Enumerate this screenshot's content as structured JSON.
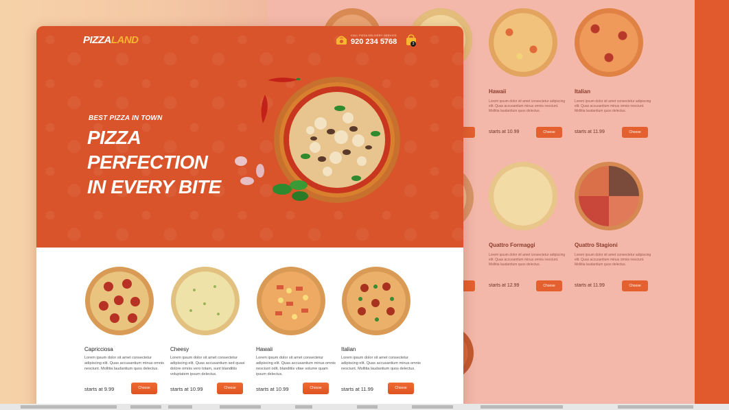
{
  "header": {
    "logo_part1": "PIZZA",
    "logo_part2": "LAND",
    "phone_label": "CALL PIZZA DELIVERY SERVICE",
    "phone_number": "920 234 5768",
    "cart_count": "3"
  },
  "hero": {
    "subtitle": "BEST PIZZA IN TOWN",
    "title_line1": "PIZZA PERFECTION",
    "title_line2": "IN EVERY BITE"
  },
  "products": [
    {
      "name": "Capricciosa",
      "desc": "Lorem ipsum dolor sit amet consectetur adipiscing elit. Quas accusantium minus omnis nesciunt. Mollitia laudantium quos delectus.",
      "price": "starts at 9.99",
      "button": "Choose",
      "icon": "pepperoni-pizza"
    },
    {
      "name": "Cheesy",
      "desc": "Lorem ipsum dolor sit amet consectetur adipiscing elit. Quas accusantium sed quasi dolore omnis vero totam, sunt blanditiis voluptatem ipsum delectus.",
      "price": "starts at 10.99",
      "button": "Choose",
      "icon": "cheese-pizza"
    },
    {
      "name": "Hawaii",
      "desc": "Lorem ipsum dolor sit amet consectetur adipiscing elit. Quas accusantium minus omnis nesciunt odit, blanditiis vitae solume quam ipsum delectus.",
      "price": "starts at 10.99",
      "button": "Choose",
      "icon": "hawaii-pizza"
    },
    {
      "name": "Italian",
      "desc": "Lorem ipsum dolor sit amet consectetur adipiscing elit. Quas accusantium minus omnis nesciunt. Mollitia laudantium quos delectus.",
      "price": "starts at 11.99",
      "button": "Choose",
      "icon": "italian-pizza"
    }
  ],
  "bg_products": [
    {
      "name": "Hawaii",
      "desc": "Lorem ipsum dolor sit amet consectetur adipiscing elit. Quas accusantium minus omnis nesciunt. Mollitia laudantium quos delectus.",
      "price": "starts at 10.99",
      "button": "Choose"
    },
    {
      "name": "Italian",
      "desc": "Lorem ipsum dolor sit amet consectetur adipiscing elit. Quas accusantium minus omnis nesciunt. Mollitia laudantium quos delectus.",
      "price": "starts at 11.99",
      "button": "Choose"
    },
    {
      "name": "Quattro Formaggi",
      "desc": "Lorem ipsum dolor sit amet consectetur adipiscing elit. Quas accusantium minus omnis nesciunt. Mollitia laudantium quos delectus.",
      "price": "starts at 12.99",
      "button": "Choose"
    },
    {
      "name": "Quattro Stagioni",
      "desc": "Lorem ipsum dolor sit amet consectetur adipiscing elit. Quas accusantium minus omnis nesciunt. Mollitia laudantium quos delectus.",
      "price": "starts at 11.99",
      "button": "Choose"
    }
  ],
  "colors": {
    "accent": "#e4602f",
    "hero_bg": "#d9542a",
    "logo_highlight": "#f8b632"
  }
}
